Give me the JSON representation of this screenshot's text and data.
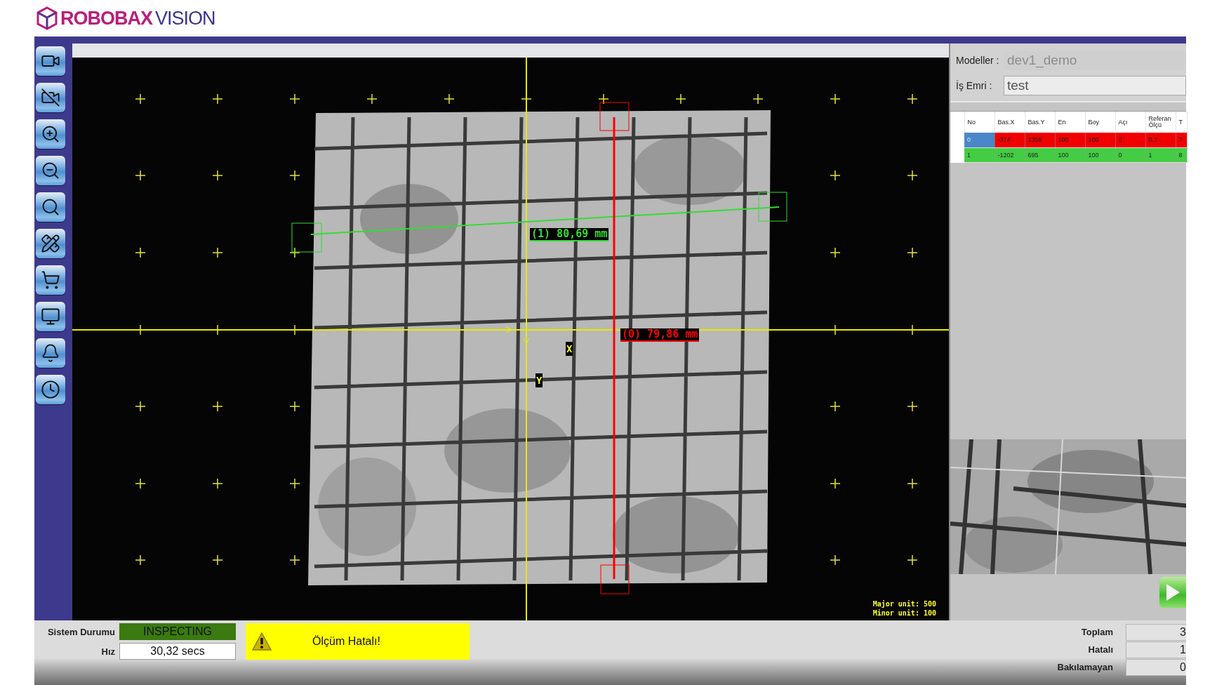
{
  "logo": {
    "brand": "ROBOBAX",
    "product": "VISION"
  },
  "viewer": {
    "measurements": [
      {
        "label": "(1) 80,69 mm",
        "color": "#33dd33"
      },
      {
        "label": "(0) 79,86 mm",
        "color": "#ff0000"
      }
    ],
    "axis_labels": [
      "X",
      "Y"
    ],
    "scale_notes": [
      "Major unit: 500",
      "Minor unit: 100"
    ]
  },
  "model_panel": {
    "fields": [
      {
        "label": "Modeller :",
        "value": "dev1_demo",
        "disabled": true
      },
      {
        "label": "İş Emri :",
        "value": "test",
        "disabled": false
      }
    ]
  },
  "table": {
    "columns": [
      "No",
      "Bas.X",
      "Bas.Y",
      "En",
      "Boy",
      "Açı",
      "Referan Ölçü",
      "T"
    ],
    "rows": [
      {
        "cells": [
          "0",
          "-374",
          "1358",
          "100",
          "100",
          "0",
          "0.3",
          "7"
        ],
        "color": "#f00000",
        "selected": true
      },
      {
        "cells": [
          "1",
          "-1202",
          "695",
          "100",
          "100",
          "0",
          "1",
          "8"
        ],
        "color": "#44cc44",
        "selected": false
      }
    ]
  },
  "status": {
    "system_label": "Sistem Durumu",
    "system_value": "INSPECTING",
    "speed_label": "Hız",
    "speed_value": "30,32 secs",
    "alert": "Ölçüm Hatalı!"
  },
  "counters": [
    {
      "label": "Toplam",
      "value": "3"
    },
    {
      "label": "Hatalı",
      "value": "1"
    },
    {
      "label": "Bakılamayan",
      "value": "0"
    }
  ]
}
